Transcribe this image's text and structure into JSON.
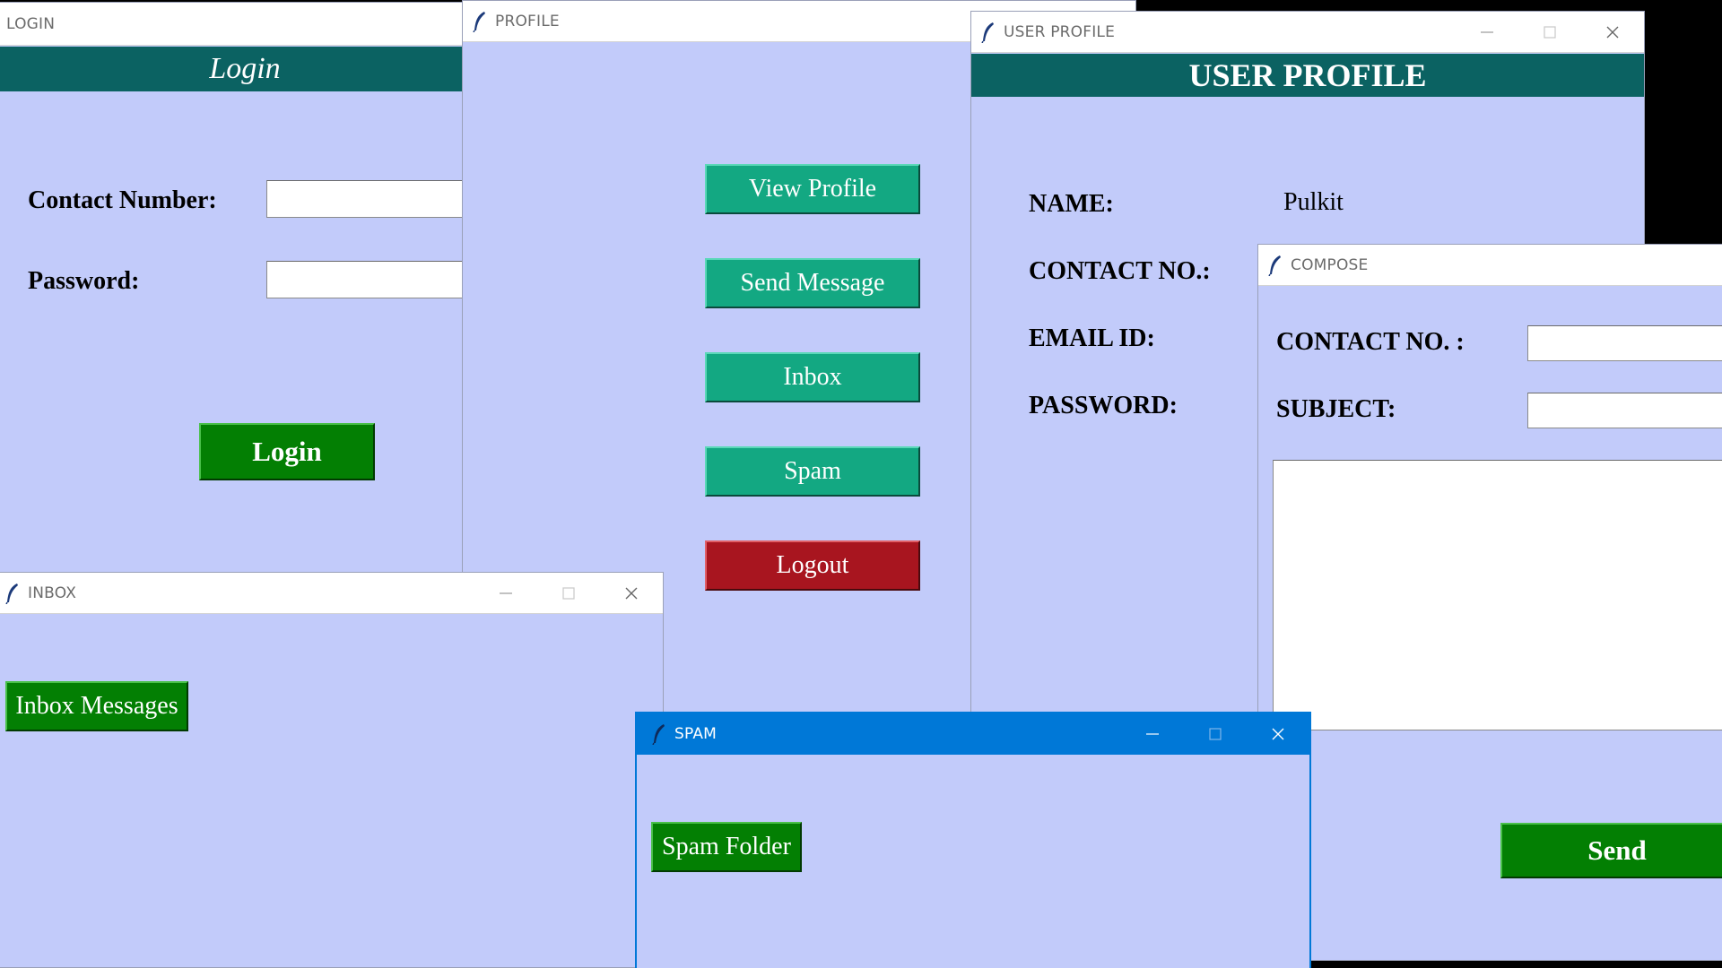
{
  "login_window": {
    "title": "LOGIN",
    "banner": "Login",
    "contact_label": "Contact Number:",
    "contact_value": "",
    "password_label": "Password:",
    "password_value": "",
    "login_button": "Login"
  },
  "profile_window": {
    "title": "PROFILE",
    "buttons": {
      "view_profile": "View Profile",
      "send_message": "Send Message",
      "inbox": "Inbox",
      "spam": "Spam",
      "logout": "Logout"
    }
  },
  "user_profile_window": {
    "title": "USER PROFILE",
    "banner": "USER PROFILE",
    "name_label": "NAME:",
    "name_value": "Pulkit",
    "contact_label": "CONTACT NO.:",
    "email_label": "EMAIL ID:",
    "password_label": "PASSWORD:"
  },
  "compose_window": {
    "title": "COMPOSE",
    "contact_label": "CONTACT NO. :",
    "contact_value": "",
    "subject_label": "SUBJECT:",
    "subject_value": "",
    "message_body": "",
    "send_button": "Send"
  },
  "inbox_window": {
    "title": "INBOX",
    "inbox_messages_button": "Inbox Messages"
  },
  "spam_window": {
    "title": "SPAM",
    "spam_folder_button": "Spam Folder"
  },
  "icons": {
    "app_icon": "feather-icon",
    "minimize": "minimize-icon",
    "maximize": "maximize-icon",
    "close": "close-icon"
  },
  "colors": {
    "window_bg": "#c2cbfa",
    "banner_bg": "#0b6262",
    "teal_button": "#13a882",
    "logout_button": "#a8151f",
    "green_button": "#037f03",
    "active_titlebar": "#0078d7"
  }
}
